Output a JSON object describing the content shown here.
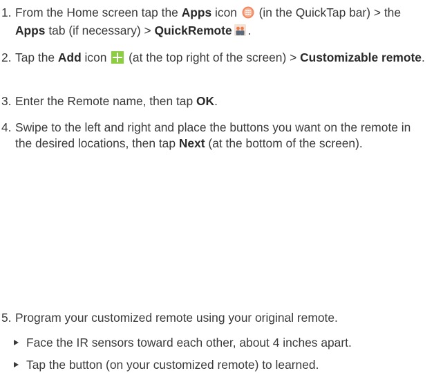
{
  "steps": [
    {
      "num": "1.",
      "parts": [
        "From the Home screen tap the ",
        "Apps",
        " icon ",
        " (in the QuickTap bar) > the ",
        "Apps",
        " tab (if necessary) > ",
        "QuickRemote",
        "."
      ]
    },
    {
      "num": "2.",
      "parts": [
        "Tap the ",
        "Add",
        " icon ",
        " (at the top right of the screen) > ",
        "Customizable remote",
        "."
      ]
    },
    {
      "num": "3.",
      "parts": [
        "Enter the Remote name, then tap ",
        "OK",
        "."
      ]
    },
    {
      "num": "4.",
      "parts": [
        "Swipe to the left and right and place the buttons you want on the remote in the desired locations, then tap ",
        "Next",
        " (at the bottom of the screen)."
      ]
    },
    {
      "num": "5.",
      "parts": [
        "Program your customized remote using your original remote."
      ]
    }
  ],
  "bullets": [
    "Face the IR sensors toward each other, about 4 inches apart.",
    "Tap the button (on your customized remote) to learned."
  ],
  "icons": {
    "apps": "apps-icon",
    "quickremote": "quickremote-icon",
    "add": "add-icon"
  },
  "colors": {
    "text": "#3a3a3a",
    "add_icon": "#8ccf3e",
    "apps_icon": "#f08b63",
    "quickremote_top": "#f07a45",
    "quickremote_bottom": "#5a6a7a"
  }
}
